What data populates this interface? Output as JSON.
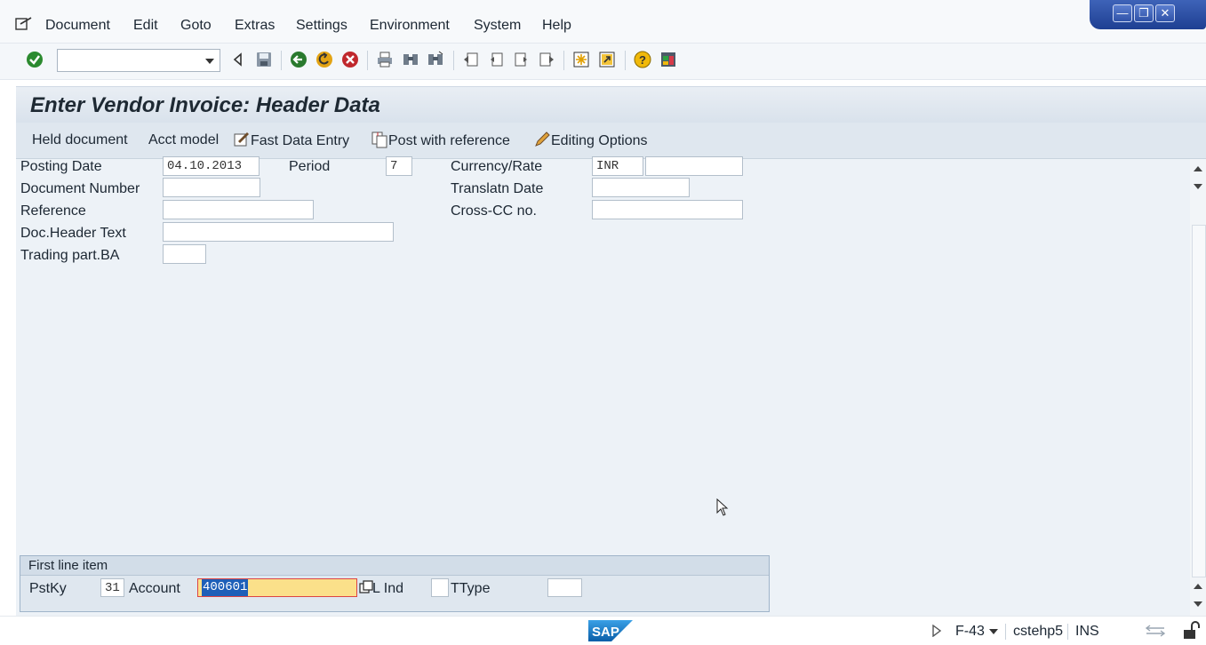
{
  "menubar": {
    "items": [
      "Document",
      "Edit",
      "Goto",
      "Extras",
      "Settings",
      "Environment",
      "System",
      "Help"
    ]
  },
  "window_controls": [
    "minimize",
    "maximize",
    "close"
  ],
  "toolbar": {
    "command_field_value": "",
    "icons": [
      "enter-icon",
      "back-nav-icon",
      "save-icon",
      "back-icon",
      "exit-icon",
      "cancel-icon",
      "print-icon",
      "find-icon",
      "find-next-icon",
      "first-page-icon",
      "previous-page-icon",
      "next-page-icon",
      "last-page-icon",
      "create-session-icon",
      "shortcut-icon",
      "help-icon",
      "layout-menu-icon"
    ]
  },
  "header": {
    "title": "Enter Vendor Invoice: Header Data"
  },
  "app_toolbar": {
    "held_document": "Held document",
    "acct_model": "Acct model",
    "fast_data_entry": "Fast Data Entry",
    "post_with_reference": "Post with reference",
    "editing_options": "Editing Options"
  },
  "form": {
    "posting_date_label": "Posting Date",
    "posting_date_value": "04.10.2013",
    "period_label": "Period",
    "period_value": "7",
    "currency_label": "Currency/Rate",
    "currency_value": "INR",
    "rate_value": "",
    "document_number_label": "Document Number",
    "document_number_value": "",
    "translation_date_label": "Translatn Date",
    "translation_date_value": "",
    "reference_label": "Reference",
    "reference_value": "",
    "cross_cc_label": "Cross-CC no.",
    "cross_cc_value": "",
    "doc_header_text_label": "Doc.Header Text",
    "doc_header_text_value": "",
    "trading_part_label": "Trading part.BA",
    "trading_part_value": ""
  },
  "first_line_item": {
    "title": "First line item",
    "pstky_label": "PstKy",
    "pstky_value": "31",
    "account_label": "Account",
    "account_value": "400601",
    "sgl_ind_label": "L Ind",
    "sgl_ind_value": "",
    "ttype_label": "TType",
    "ttype_value": ""
  },
  "statusbar": {
    "transaction": "F-43",
    "server": "cstehp5",
    "mode": "INS",
    "logo_text": "SAP"
  },
  "colors": {
    "title_band": "#d9e2ec",
    "form_bg": "#edf2f7",
    "window_controls": "#2a4fa3",
    "account_highlight": "#fbe08a",
    "selection": "#1e5fb8"
  }
}
